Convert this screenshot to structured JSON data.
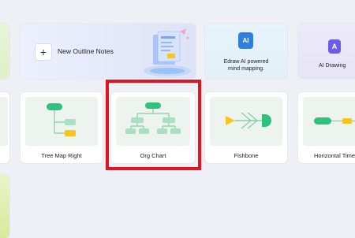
{
  "templates": {
    "new_outline": {
      "label": "New Outline Notes",
      "plus": "+"
    },
    "ai_mind": {
      "badge": "AI",
      "label_line1": "Edraw AI powered",
      "label_line2": "mind mapping."
    },
    "ai_drawing": {
      "badge": "A",
      "label": "AI Drawing"
    },
    "tree_map_right": {
      "label": "Tree Map Right"
    },
    "org_chart": {
      "label": "Org Chart"
    },
    "fishbone": {
      "label": "Fishbone"
    },
    "horizontal_timeline": {
      "label": "Horizontal Time"
    }
  },
  "colors": {
    "accent_green": "#2ec27e",
    "accent_yellow": "#f7c61a",
    "light_green": "#a8e0c2",
    "highlight_red": "#e01520",
    "ai_blue": "#2d7fe0",
    "ai_purple": "#6c5ce7"
  }
}
